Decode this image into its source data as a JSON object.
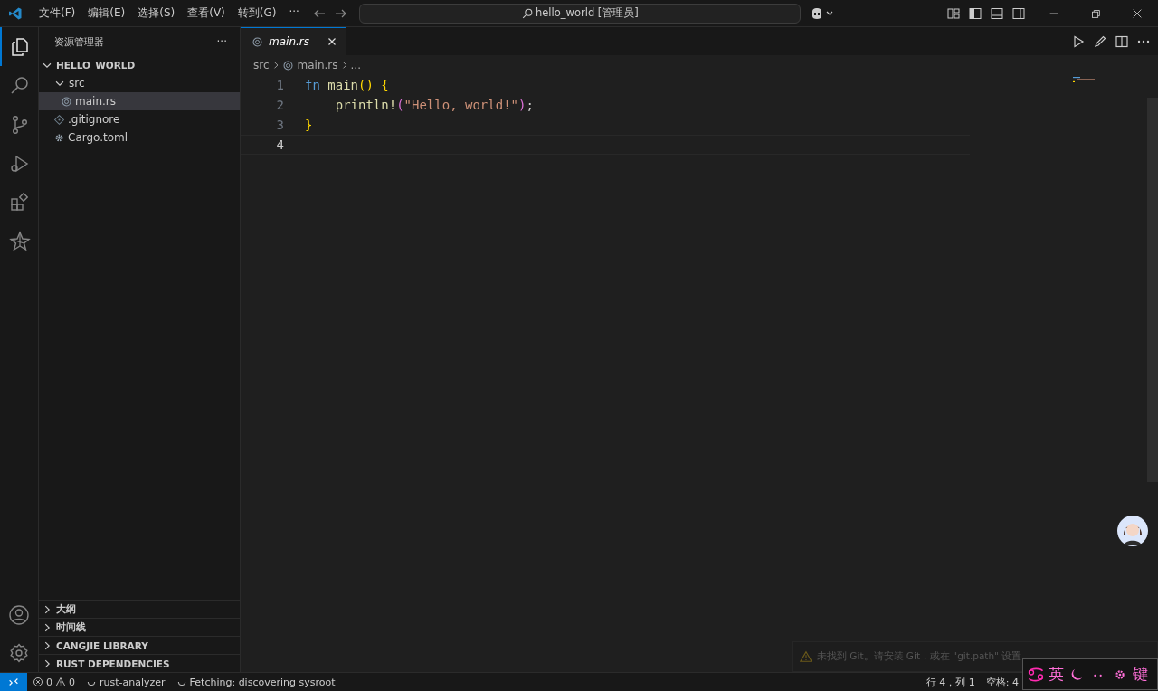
{
  "title_bar": {
    "menu": [
      "文件(F)",
      "编辑(E)",
      "选择(S)",
      "查看(V)",
      "转到(G)"
    ],
    "more": "···",
    "search": "hello_world [管理员]"
  },
  "activity_bar": [
    {
      "kind": "files",
      "selected": true
    },
    {
      "kind": "search",
      "selected": false
    },
    {
      "kind": "source-control",
      "selected": false
    },
    {
      "kind": "run",
      "selected": false
    },
    {
      "kind": "extensions",
      "selected": false
    },
    {
      "kind": "star",
      "selected": false
    }
  ],
  "sidebar": {
    "title": "资源管理器",
    "more": "···",
    "root": {
      "label": "HELLO_WORLD",
      "expanded": true,
      "children": [
        {
          "label": "src",
          "kind": "folder",
          "expanded": true,
          "selected": false,
          "children": [
            {
              "label": "main.rs",
              "kind": "rust",
              "selected": true
            }
          ]
        },
        {
          "label": ".gitignore",
          "kind": "git",
          "selected": false
        },
        {
          "label": "Cargo.toml",
          "kind": "gear",
          "selected": false
        }
      ]
    },
    "panels": [
      {
        "label": "大纲",
        "expanded": false
      },
      {
        "label": "时间线",
        "expanded": false
      },
      {
        "label": "CANGJIE LIBRARY",
        "expanded": false
      },
      {
        "label": "RUST DEPENDENCIES",
        "expanded": false
      }
    ]
  },
  "tabs": [
    {
      "label": "main.rs",
      "selected": true,
      "preview": true
    }
  ],
  "breadcrumbs": [
    "src",
    "main.rs",
    "..."
  ],
  "editor": {
    "lines": [
      {
        "number": "1",
        "current": false,
        "tokens": [
          {
            "kind": "keyword",
            "text": "fn"
          },
          {
            "kind": "function",
            "text": " main"
          },
          {
            "kind": "paren",
            "text": "()"
          },
          {
            "kind": "paren",
            "text": " {"
          }
        ]
      },
      {
        "number": "2",
        "current": false,
        "indent": true,
        "tokens": [
          {
            "kind": "function",
            "text": "println!"
          },
          {
            "kind": "paren2",
            "text": "("
          },
          {
            "kind": "string",
            "text": "\"Hello, world!\""
          },
          {
            "kind": "paren2",
            "text": ")"
          },
          {
            "kind": "plain",
            "text": ";"
          }
        ]
      },
      {
        "number": "3",
        "current": false,
        "tokens": [
          {
            "kind": "paren",
            "text": "}"
          }
        ]
      },
      {
        "number": "4",
        "current": true
      }
    ]
  },
  "notification": {
    "text": "未找到 Git。请安装 Git，或在 \"git.path\" 设置"
  },
  "ime_bar": {
    "mode": "英",
    "key": "键"
  },
  "status_bar": {
    "errors": "0",
    "warnings": "0",
    "items": [
      {
        "kind": "spinner",
        "text": "rust-analyzer"
      },
      {
        "kind": "spinner",
        "text": "Fetching: discovering sysroot"
      }
    ],
    "right": [
      "行 4，列 1",
      "空格: 4"
    ]
  }
}
